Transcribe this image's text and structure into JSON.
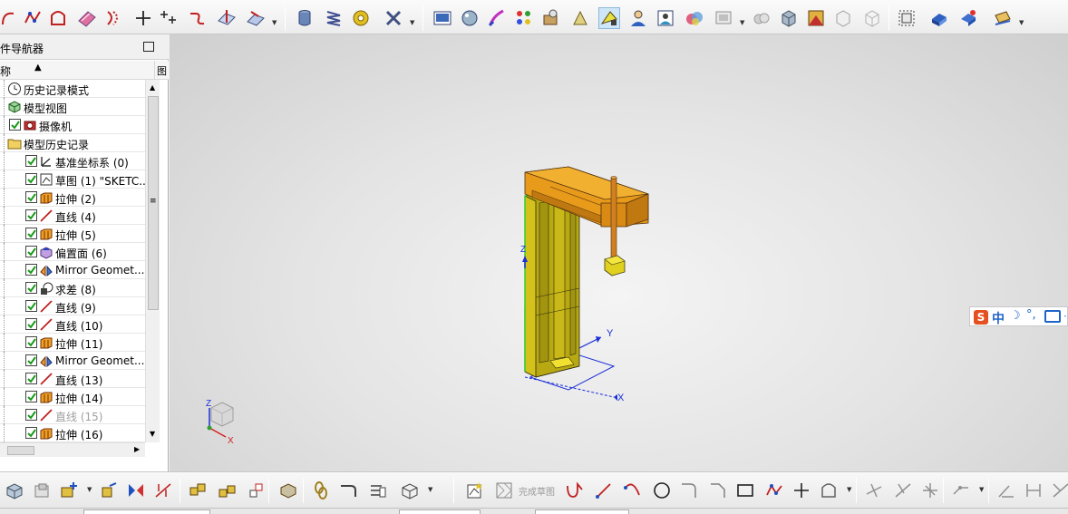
{
  "navigator": {
    "title": "部件导航器",
    "column_name": "名称",
    "column2_header": "图",
    "rows": [
      {
        "label": "历史记录模式",
        "icon": "clock-icon",
        "checked": null,
        "level": 0
      },
      {
        "label": "模型视图",
        "icon": "model-views-icon",
        "checked": null,
        "level": 0
      },
      {
        "label": "摄像机",
        "icon": "camera-icon",
        "checked": true,
        "level": 0
      },
      {
        "label": "模型历史记录",
        "icon": "folder-icon",
        "checked": null,
        "level": 0
      },
      {
        "label": "基准坐标系 (0)",
        "icon": "datum-csys-icon",
        "checked": true,
        "level": 1
      },
      {
        "label": "草图 (1) \"SKETC...",
        "icon": "sketch-icon",
        "checked": true,
        "level": 1
      },
      {
        "label": "拉伸 (2)",
        "icon": "extrude-icon",
        "checked": true,
        "level": 1
      },
      {
        "label": "直线 (4)",
        "icon": "line-icon",
        "checked": true,
        "level": 1
      },
      {
        "label": "拉伸 (5)",
        "icon": "extrude-icon",
        "checked": true,
        "level": 1
      },
      {
        "label": "偏置面 (6)",
        "icon": "offset-face-icon",
        "checked": true,
        "level": 1
      },
      {
        "label": "Mirror Geomet...",
        "icon": "mirror-geometry-icon",
        "checked": true,
        "level": 1
      },
      {
        "label": "求差 (8)",
        "icon": "subtract-icon",
        "checked": true,
        "level": 1
      },
      {
        "label": "直线 (9)",
        "icon": "line-icon",
        "checked": true,
        "level": 1
      },
      {
        "label": "直线 (10)",
        "icon": "line-icon",
        "checked": true,
        "level": 1
      },
      {
        "label": "拉伸 (11)",
        "icon": "extrude-icon",
        "checked": true,
        "level": 1
      },
      {
        "label": "Mirror Geomet...",
        "icon": "mirror-geometry-icon",
        "checked": true,
        "level": 1
      },
      {
        "label": "直线 (13)",
        "icon": "line-icon",
        "checked": true,
        "level": 1
      },
      {
        "label": "拉伸 (14)",
        "icon": "extrude-icon",
        "checked": true,
        "level": 1
      },
      {
        "label": "直线 (15)",
        "icon": "line-icon",
        "checked": true,
        "level": 1,
        "dim": true
      },
      {
        "label": "拉伸 (16)",
        "icon": "extrude-icon",
        "checked": true,
        "level": 1
      }
    ]
  },
  "viewport": {
    "axis_labels": {
      "x": "X",
      "y": "Y",
      "z": "Z"
    },
    "triad_labels": {
      "x": "X",
      "z": "Z"
    },
    "colors": {
      "body": "#d4c21a",
      "body_dark": "#9a8c10",
      "beam": "#e89a1a",
      "axis_blue": "#1a2fd8",
      "triad_red": "#d42020"
    }
  },
  "ime": {
    "logo": "S",
    "mode": "中",
    "moon": "☽",
    "punct": "°,",
    "more": "⋯"
  },
  "bottom_toolbar": {
    "finish_sketch_label": "完成草图"
  }
}
